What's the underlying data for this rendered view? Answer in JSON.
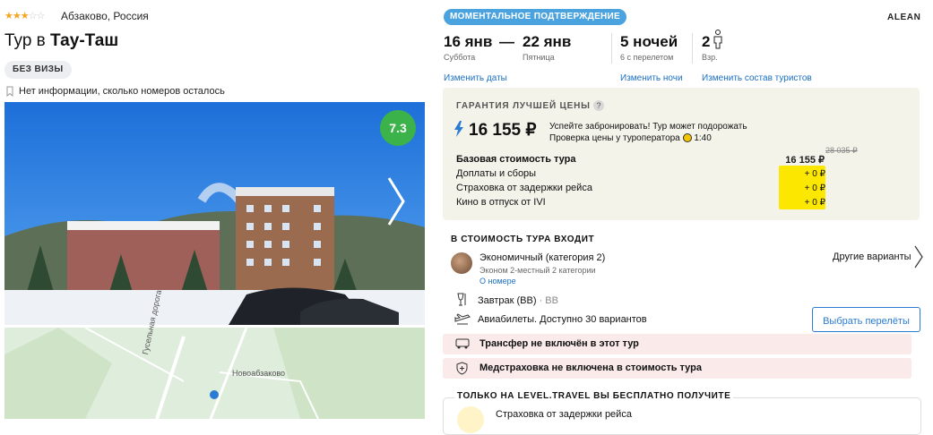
{
  "hotel": {
    "stars": 3,
    "location": "Абзаково, Россия",
    "title_prefix": "Тур в",
    "title_name": "Тау-Таш",
    "visa_badge": "БЕЗ ВИЗЫ",
    "rooms_info": "Нет информации, сколько номеров осталось",
    "rating": "7.3",
    "rating_color": "#3bb34a"
  },
  "map": {
    "place_label": "Новоабзаково",
    "road_label": "Гусельная дорога"
  },
  "booking": {
    "instant_badge": "МОМЕНТАЛЬНОЕ ПОДТВЕРЖДЕНИЕ",
    "operator": "ALEAN",
    "date_from": "16 янв",
    "date_from_day": "Суббота",
    "dash": "—",
    "date_to": "22 янв",
    "date_to_day": "Пятница",
    "nights": "5 ночей",
    "nights_sub": "6 с перелетом",
    "adults": "2",
    "adults_sub": "Взр.",
    "change_dates": "Изменить даты",
    "change_nights": "Изменить ночи",
    "change_tourists": "Изменить состав туристов"
  },
  "price": {
    "guarantee_label": "ГАРАНТИЯ ЛУЧШЕЙ ЦЕНЫ",
    "question": "?",
    "total": "16 155 ₽",
    "hurry_line1": "Успейте забронировать! Тур может подорожать",
    "hurry_line2": "Проверка цены у туроператора",
    "timer": "1:40",
    "old_price": "28 035 ₽",
    "rows": [
      {
        "label": "Базовая стоимость тура",
        "value": "16 155 ₽"
      },
      {
        "label": "Доплаты и сборы",
        "value": "+ 0 ₽"
      },
      {
        "label": "Страховка от задержки рейса",
        "value": "+ 0 ₽"
      },
      {
        "label": "Кино в отпуск от IVI",
        "value": "+ 0 ₽"
      }
    ],
    "accent_color": "#fbe700"
  },
  "includes": {
    "title": "В СТОИМОСТЬ ТУРА ВХОДИТ",
    "room_name": "Экономичный (категория 2)",
    "room_sub": "Эконом 2-местный 2 категории",
    "room_link": "О номере",
    "other_options": "Другие варианты",
    "meal": "Завтрак (BB)",
    "meal_code": "· BB",
    "flight": "Авиабилеты. Доступно 30 вариантов",
    "choose_flights": "Выбрать перелёты",
    "transfer_alert": "Трансфер не включён в этот тур",
    "insurance_alert": "Медстраховка не включена в стоимость тура",
    "alert_color": "#fbeaea"
  },
  "free": {
    "title": "ТОЛЬКО НА LEVEL.TRAVEL ВЫ БЕСПЛАТНО ПОЛУЧИТЕ",
    "item": "Страховка от задержки рейса"
  }
}
